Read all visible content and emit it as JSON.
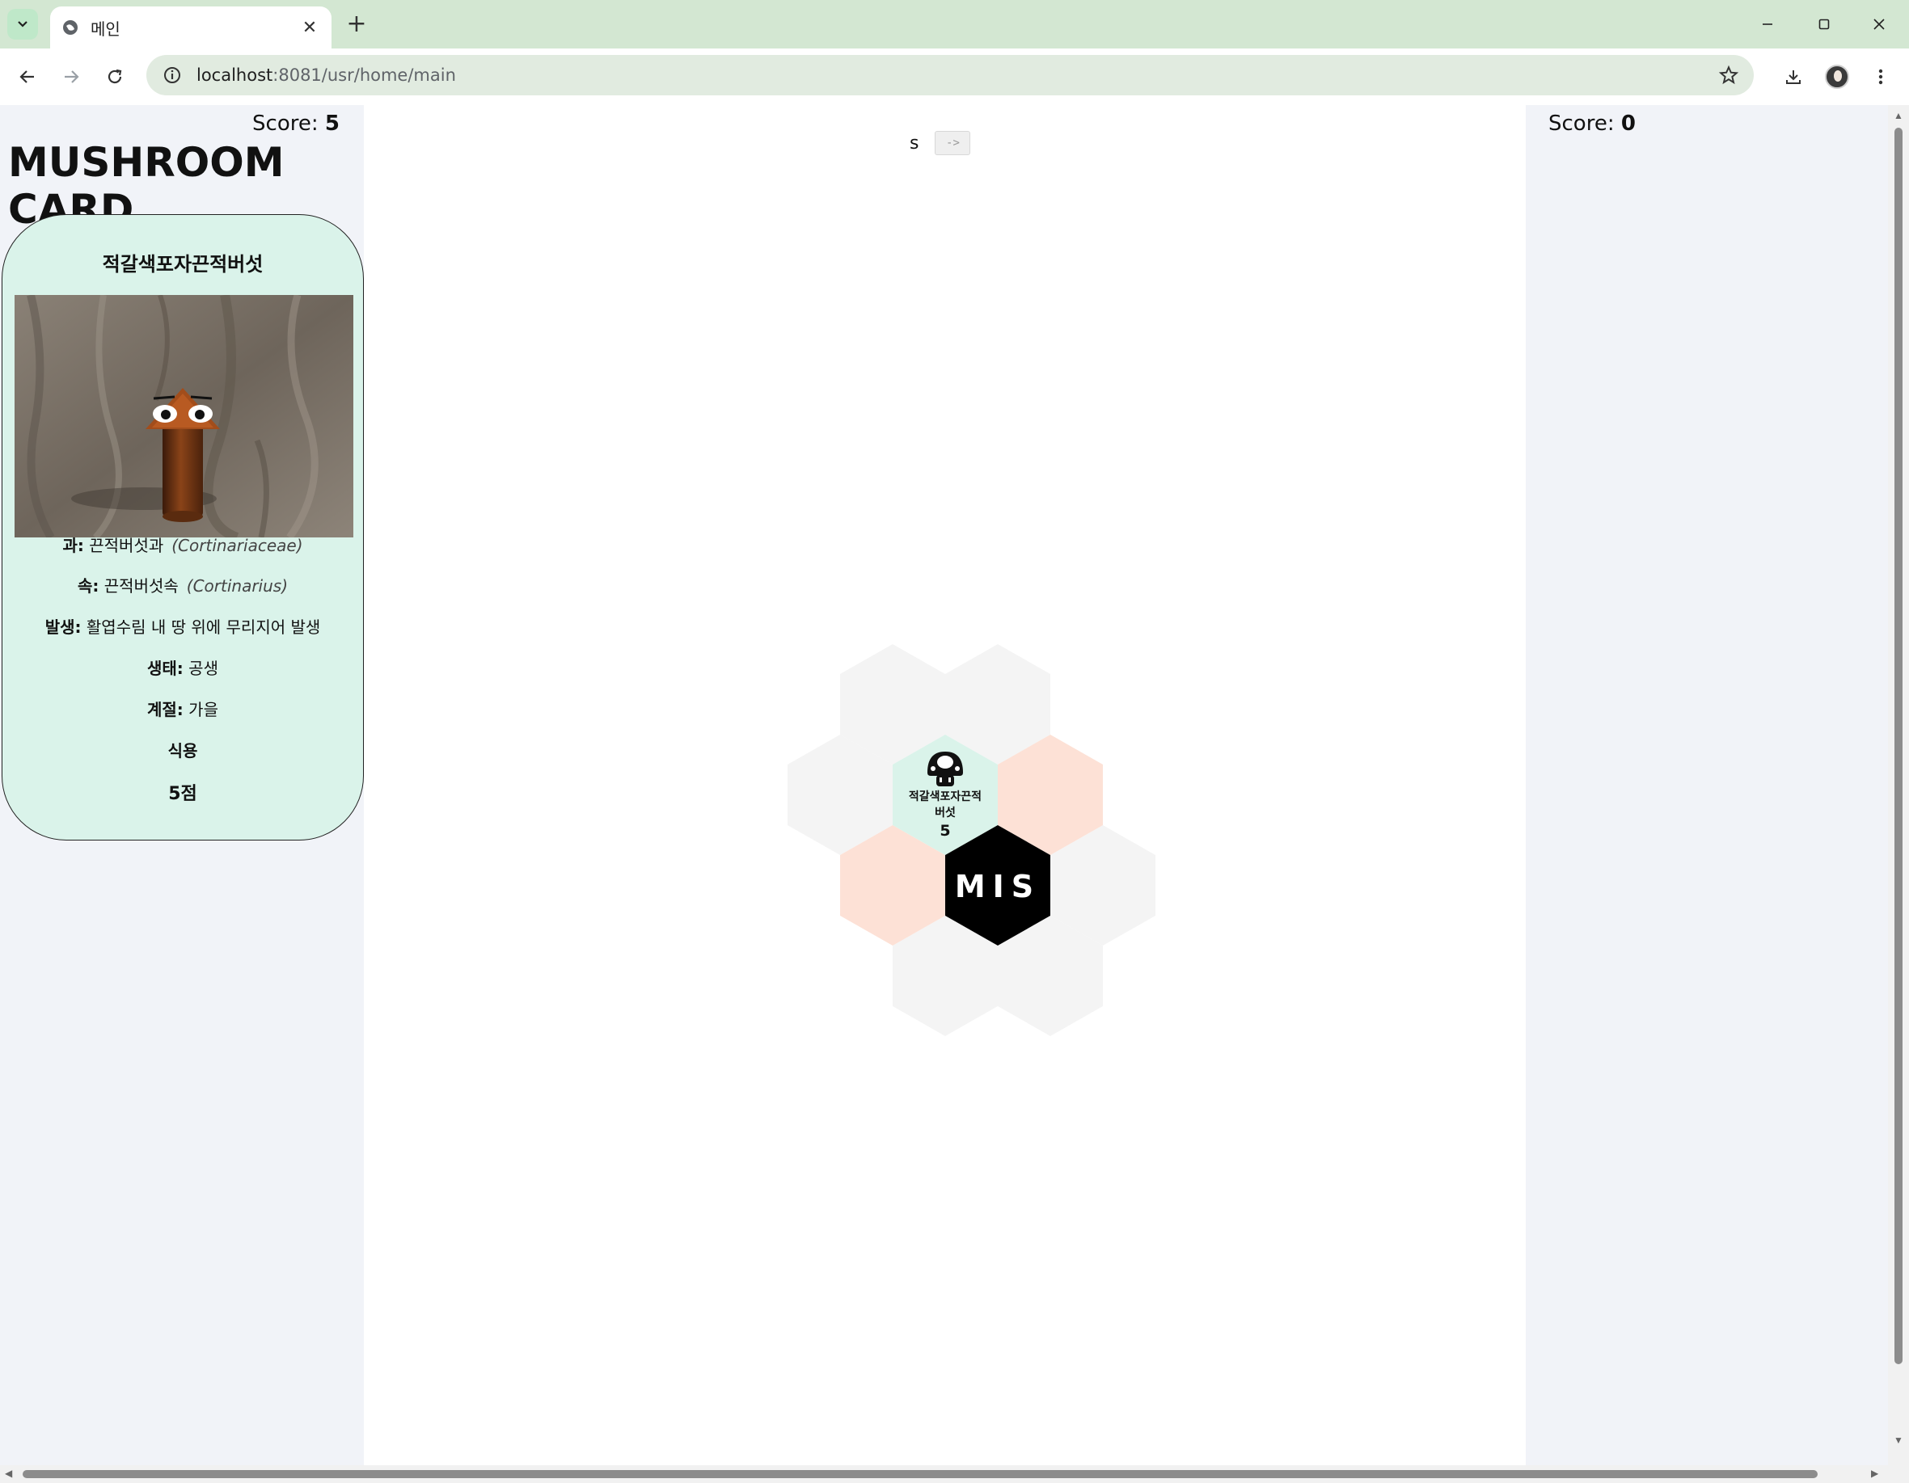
{
  "browser": {
    "tab_title": "메인",
    "url_host": "localhost",
    "url_rest": ":8081/usr/home/main",
    "new_tab_glyph": "+",
    "close_glyph": "✕"
  },
  "left_panel": {
    "score_label": "Score:",
    "score_value": "5",
    "title": "MUSHROOM CARD",
    "card": {
      "name": "적갈색포자끈적버섯",
      "image_alt": "mushroom character",
      "family_label": "과:",
      "family_value": "끈적버섯과",
      "family_latin": "(Cortinariaceae)",
      "genus_label": "속:",
      "genus_value": "끈적버섯속",
      "genus_latin": "(Cortinarius)",
      "occurrence_label": "발생:",
      "occurrence_value": "활엽수림 내 땅 위에 무리지어 발생",
      "ecology_label": "생태:",
      "ecology_value": "공생",
      "season_label": "계절:",
      "season_value": "가을",
      "edibility": "식용",
      "points": "5점"
    }
  },
  "right_panel": {
    "score_label": "Score:",
    "score_value": "0"
  },
  "center": {
    "input_text": "s",
    "submit_label": "->",
    "board": {
      "placed_tile": {
        "name_line1": "적갈색포자끈적",
        "name_line2": "버섯",
        "points": "5"
      },
      "center_tile": "MIS"
    }
  },
  "colors": {
    "tabbar": "#d3e7d2",
    "card_bg": "#daf3ea",
    "hex_empty": "#f4f4f4",
    "hex_highlight": "#fde1d6",
    "hex_placed": "#daf3ea",
    "hex_center": "#000000",
    "panel_bg": "#f1f3f8"
  }
}
